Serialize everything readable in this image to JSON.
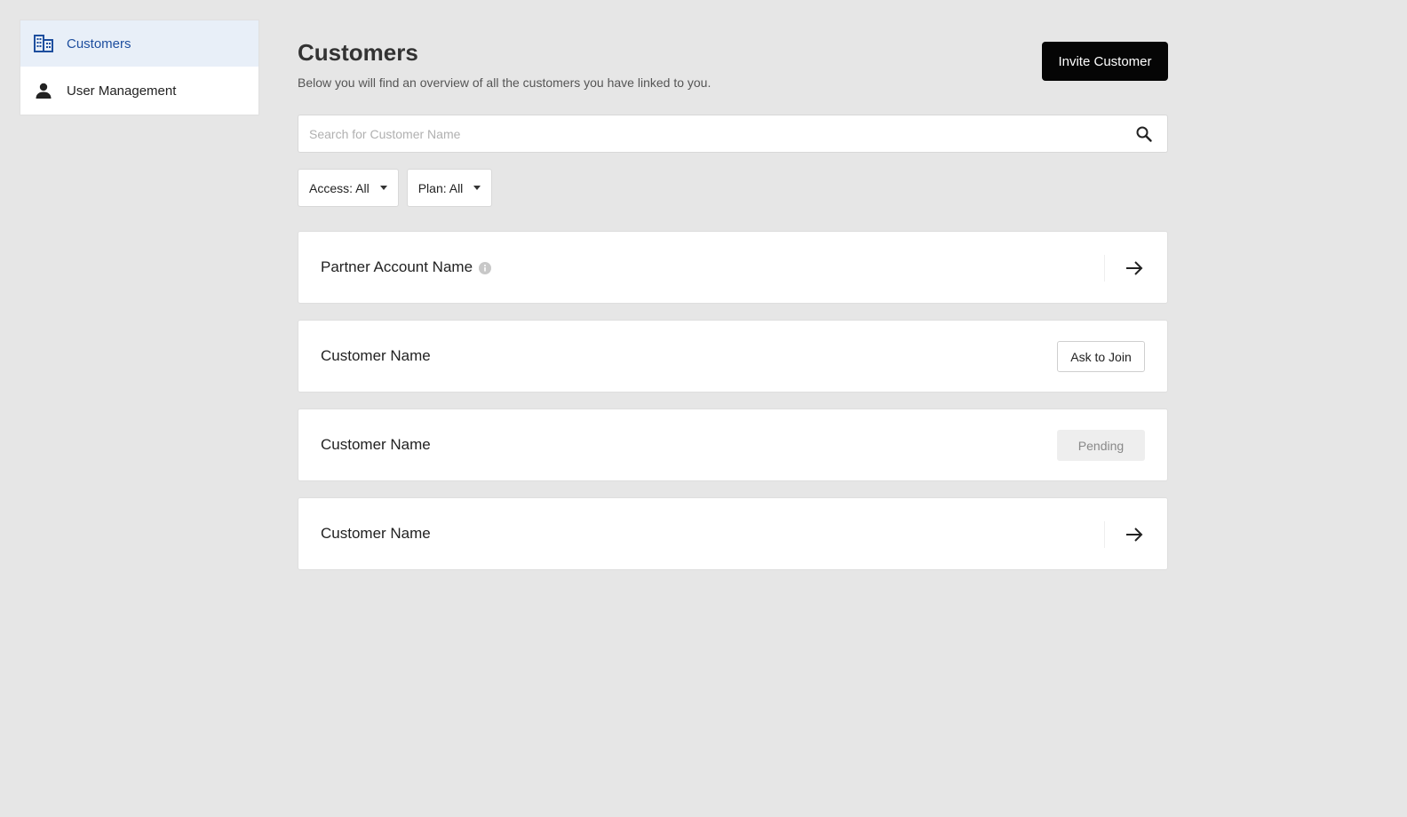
{
  "sidebar": {
    "items": [
      {
        "label": "Customers",
        "icon": "building-icon",
        "active": true
      },
      {
        "label": "User Management",
        "icon": "person-icon",
        "active": false
      }
    ]
  },
  "header": {
    "title": "Customers",
    "subtitle": "Below you will find an overview of all the customers you have linked to you.",
    "invite_label": "Invite Customer"
  },
  "search": {
    "placeholder": "Search for Customer Name",
    "value": ""
  },
  "filters": [
    {
      "label": "Access: All"
    },
    {
      "label": "Plan: All"
    }
  ],
  "rows": [
    {
      "name": "Partner Account Name",
      "action": "arrow",
      "info": true
    },
    {
      "name": "Customer Name",
      "action": "ask",
      "action_label": "Ask to Join"
    },
    {
      "name": "Customer Name",
      "action": "pending",
      "action_label": "Pending"
    },
    {
      "name": "Customer Name",
      "action": "arrow"
    }
  ],
  "colors": {
    "accent": "#1d4e9e",
    "active_bg": "#e8eff8",
    "primary_button": "#050505",
    "page_bg": "#e6e6e6"
  }
}
